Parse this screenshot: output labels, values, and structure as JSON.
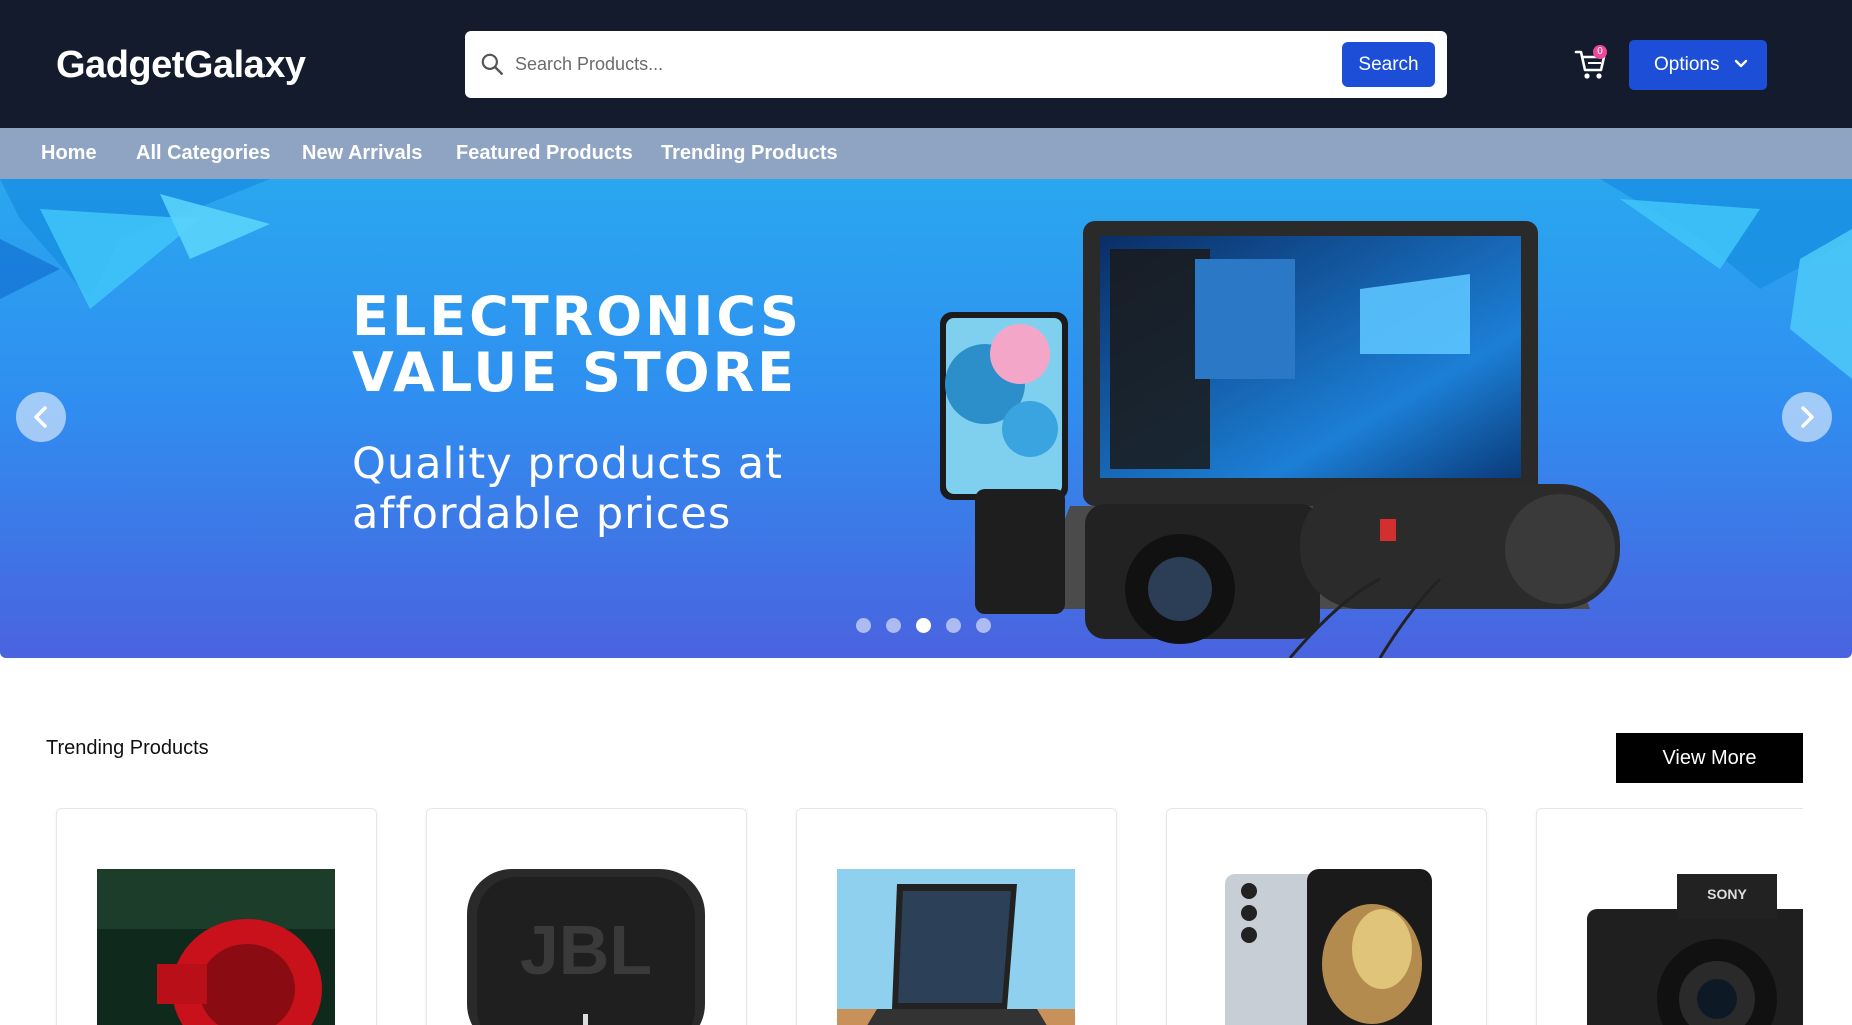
{
  "header": {
    "logo": "GadgetGalaxy",
    "search_placeholder": "Search Products...",
    "search_button": "Search",
    "cart_count": "0",
    "options_label": "Options"
  },
  "nav": {
    "items": [
      "Home",
      "All Categories",
      "New Arrivals",
      "Featured Products",
      "Trending Products"
    ]
  },
  "hero": {
    "title_line1": "ELECTRONICS",
    "title_line2": "VALUE STORE",
    "subtitle_line1": "Quality products at",
    "subtitle_line2": "affordable prices",
    "slide_count": 5,
    "active_slide": 3
  },
  "trending": {
    "title": "Trending Products",
    "view_more": "View More",
    "products": [
      {
        "image": "red-watch"
      },
      {
        "image": "jbl-speaker"
      },
      {
        "image": "laptop"
      },
      {
        "image": "smartphone"
      },
      {
        "image": "sony-camera"
      }
    ]
  },
  "colors": {
    "header_bg": "#141b2d",
    "navbar_bg": "#8fa4c3",
    "accent": "#1d4ed8",
    "badge": "#ec4899"
  }
}
